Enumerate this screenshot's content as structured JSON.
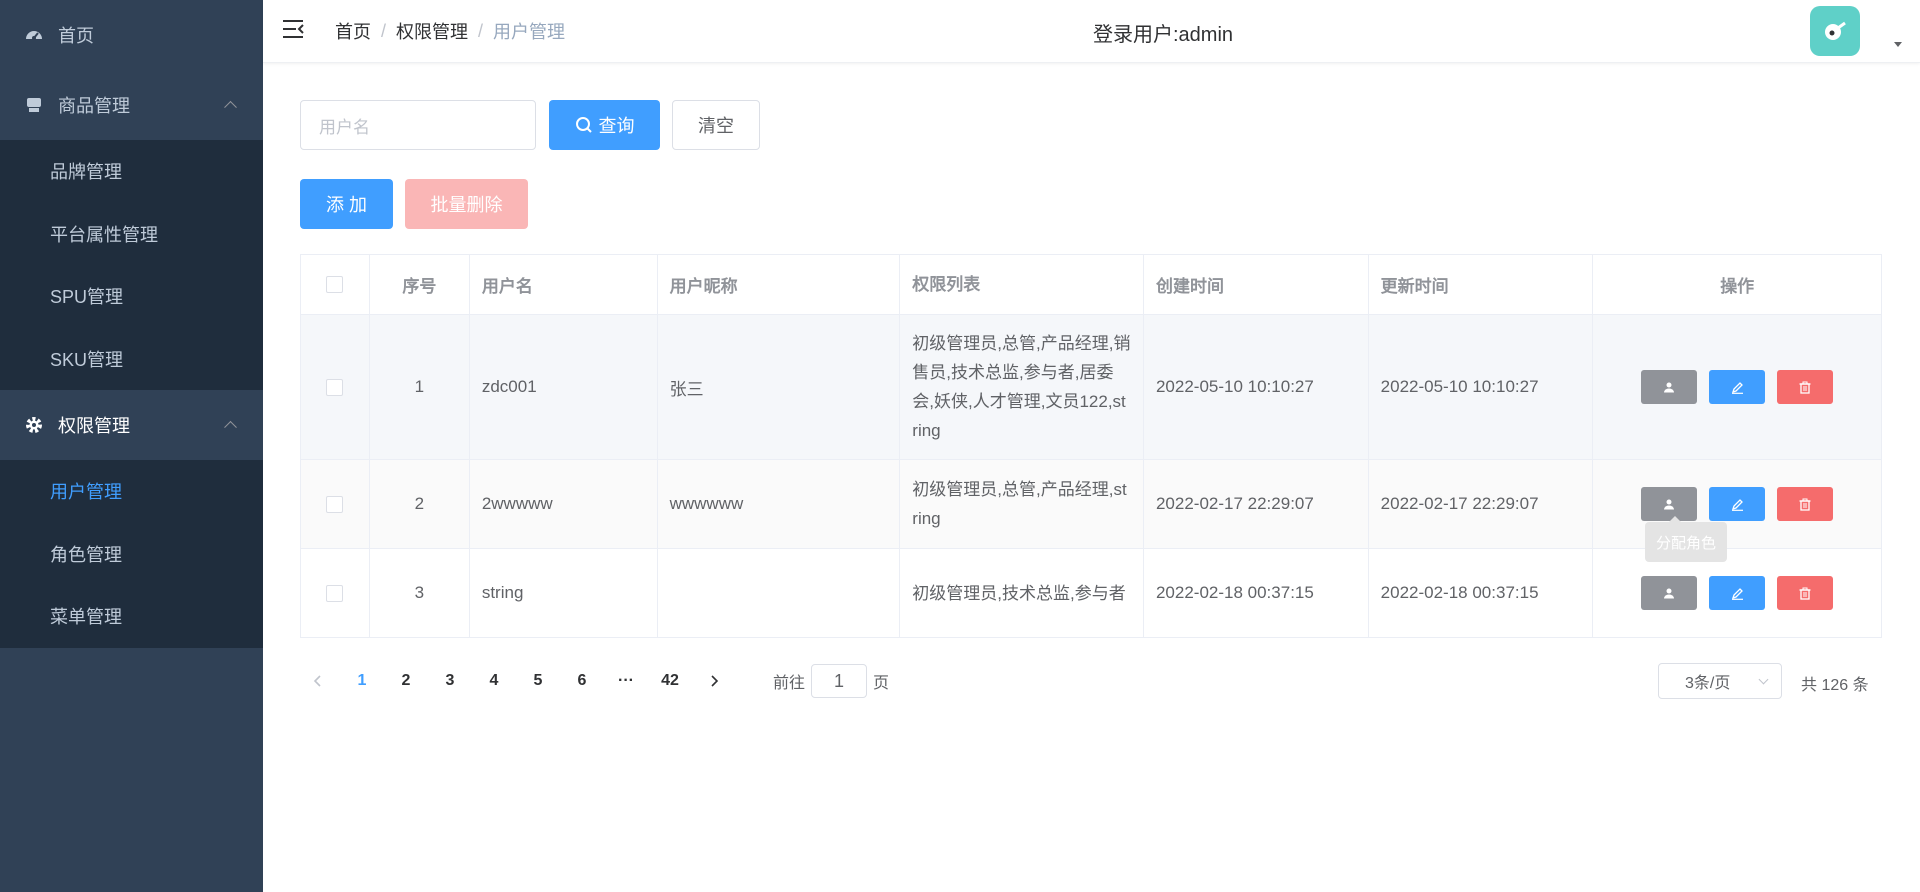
{
  "sidebar": {
    "home": {
      "label": "首页",
      "icon": "dashboard-icon"
    },
    "goods": {
      "label": "商品管理",
      "icon": "shop-icon",
      "children": [
        {
          "label": "品牌管理"
        },
        {
          "label": "平台属性管理"
        },
        {
          "label": "SPU管理"
        },
        {
          "label": "SKU管理"
        }
      ]
    },
    "perm": {
      "label": "权限管理",
      "icon": "gear-icon",
      "children": [
        {
          "label": "用户管理",
          "active": true
        },
        {
          "label": "角色管理"
        },
        {
          "label": "菜单管理"
        }
      ]
    }
  },
  "header": {
    "breadcrumb": [
      "首页",
      "权限管理",
      "用户管理"
    ],
    "sep": "/",
    "login_user": "登录用户:admin"
  },
  "search": {
    "placeholder": "用户名",
    "query_label": "查询",
    "clear_label": "清空"
  },
  "actions": {
    "add_label": "添 加",
    "batch_delete_label": "批量删除"
  },
  "table": {
    "headers": [
      "序号",
      "用户名",
      "用户昵称",
      "权限列表",
      "创建时间",
      "更新时间",
      "操作"
    ],
    "rows": [
      {
        "idx": "1",
        "username": "zdc001",
        "nickname": "张三",
        "perms": "初级管理员,总管,产品经理,销售员,技术总监,参与者,居委会,妖侠,人才管理,文员122,string",
        "created": "2022-05-10 10:10:27",
        "updated": "2022-05-10 10:10:27"
      },
      {
        "idx": "2",
        "username": "2wwwww",
        "nickname": "wwwwww",
        "perms": "初级管理员,总管,产品经理,string",
        "created": "2022-02-17 22:29:07",
        "updated": "2022-02-17 22:29:07"
      },
      {
        "idx": "3",
        "username": "string",
        "nickname": "",
        "perms": "初级管理员,技术总监,参与者",
        "created": "2022-02-18 00:37:15",
        "updated": "2022-02-18 00:37:15"
      }
    ],
    "tooltip": "分配角色"
  },
  "pagination": {
    "pages": [
      "1",
      "2",
      "3",
      "4",
      "5",
      "6",
      "···",
      "42"
    ],
    "current": "1",
    "goto_prefix": "前往",
    "goto_value": "1",
    "goto_suffix": "页",
    "page_size": "3条/页",
    "total": "共 126 条"
  },
  "colors": {
    "sidebar_bg": "#304156",
    "submenu_bg": "#1f2d3d",
    "primary": "#409eff",
    "danger": "#f56c6c",
    "info": "#909399"
  }
}
